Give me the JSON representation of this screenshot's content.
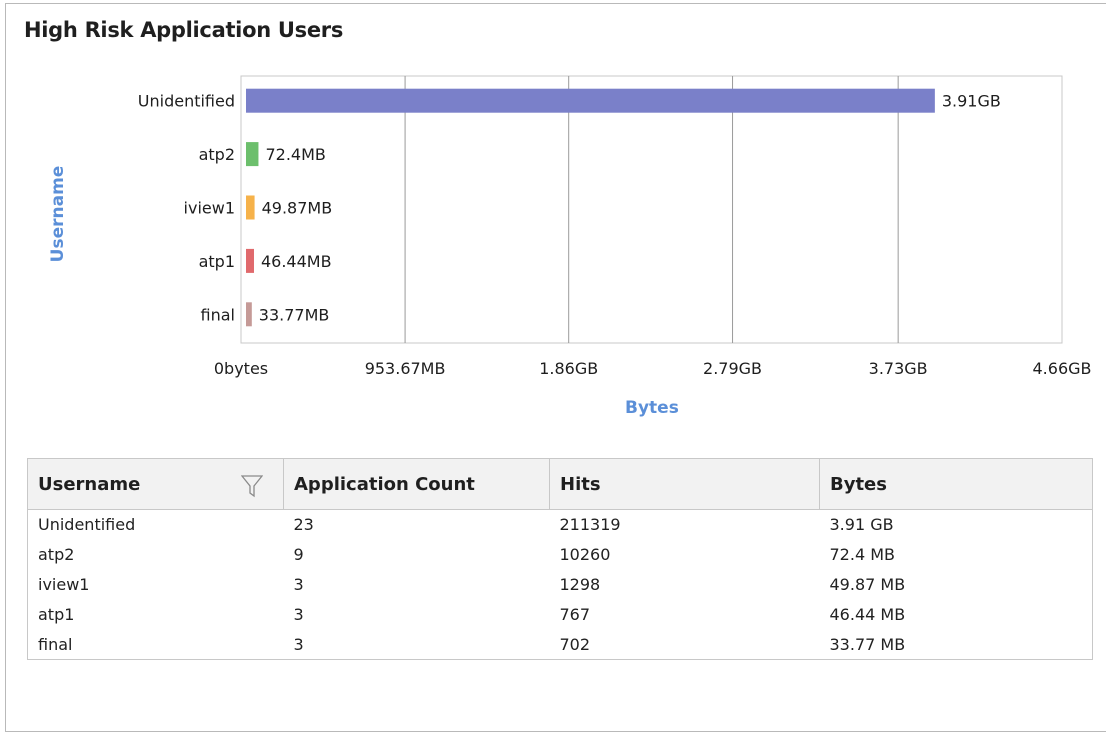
{
  "title": "High Risk Application Users",
  "chart_data": {
    "type": "bar",
    "orientation": "horizontal",
    "categories": [
      "Unidentified",
      "atp2",
      "iview1",
      "atp1",
      "final"
    ],
    "values_mb": [
      4003.84,
      72.4,
      49.87,
      46.44,
      33.77
    ],
    "value_labels": [
      "3.91GB",
      "72.4MB",
      "49.87MB",
      "46.44MB",
      "33.77MB"
    ],
    "colors": [
      "#7a80c9",
      "#6cbf6c",
      "#f6b24a",
      "#e0696c",
      "#c59a97"
    ],
    "xlabel": "Bytes",
    "ylabel": "Username",
    "x_ticks_mb": [
      0,
      953.67,
      1904.64,
      2856.96,
      3819.52,
      4771.84
    ],
    "x_tick_labels": [
      "0bytes",
      "953.67MB",
      "1.86GB",
      "2.79GB",
      "3.73GB",
      "4.66GB"
    ],
    "xlim_mb": [
      0,
      4771.84
    ],
    "grid": true
  },
  "table": {
    "columns": [
      "Username",
      "Application Count",
      "Hits",
      "Bytes"
    ],
    "rows": [
      [
        "Unidentified",
        "23",
        "211319",
        "3.91 GB"
      ],
      [
        "atp2",
        "9",
        "10260",
        "72.4 MB"
      ],
      [
        "iview1",
        "3",
        "1298",
        "49.87 MB"
      ],
      [
        "atp1",
        "3",
        "767",
        "46.44 MB"
      ],
      [
        "final",
        "3",
        "702",
        "33.77 MB"
      ]
    ]
  },
  "icons": {
    "filter": "filter-funnel-icon"
  }
}
